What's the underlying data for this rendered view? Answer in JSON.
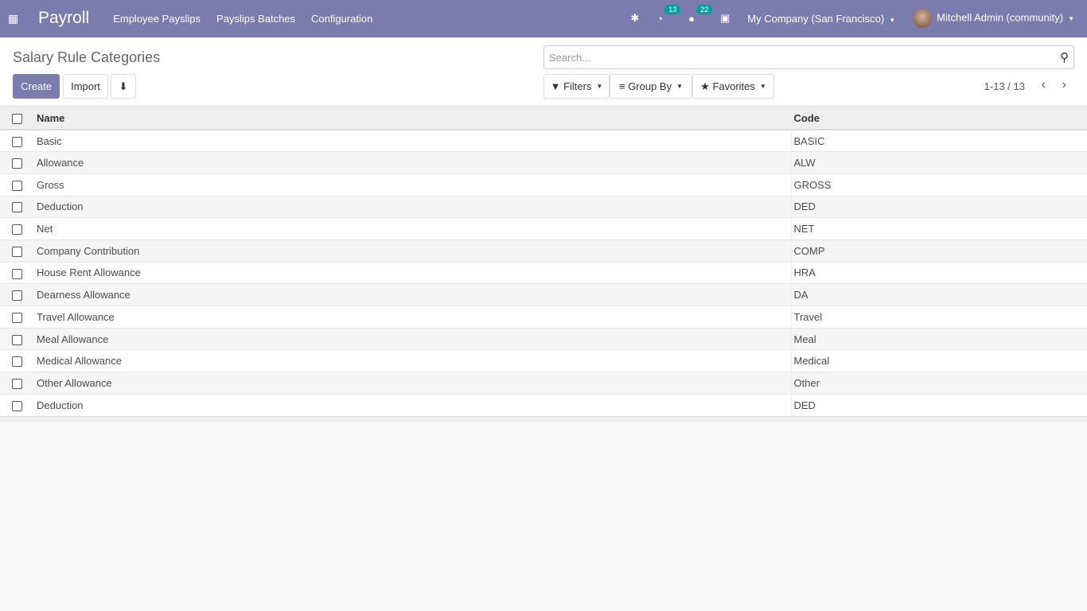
{
  "nav": {
    "brand": "Payroll",
    "menus": [
      "Employee Payslips",
      "Payslips Batches",
      "Configuration"
    ],
    "activity_count": "13",
    "message_count": "22",
    "company": "My Company (San Francisco)",
    "user": "Mitchell Admin (community)"
  },
  "control": {
    "title": "Salary Rule Categories",
    "create": "Create",
    "import": "Import",
    "search_placeholder": "Search...",
    "filters": "Filters",
    "group_by": "Group By",
    "favorites": "Favorites",
    "pager": "1-13 / 13"
  },
  "table": {
    "headers": [
      "Name",
      "Code"
    ],
    "rows": [
      [
        "Basic",
        "BASIC"
      ],
      [
        "Allowance",
        "ALW"
      ],
      [
        "Gross",
        "GROSS"
      ],
      [
        "Deduction",
        "DED"
      ],
      [
        "Net",
        "NET"
      ],
      [
        "Company Contribution",
        "COMP"
      ],
      [
        "House Rent Allowance",
        "HRA"
      ],
      [
        "Dearness Allowance",
        "DA"
      ],
      [
        "Travel Allowance",
        "Travel"
      ],
      [
        "Meal Allowance",
        "Meal"
      ],
      [
        "Medical Allowance",
        "Medical"
      ],
      [
        "Other Allowance",
        "Other"
      ],
      [
        "Deduction",
        "DED"
      ]
    ]
  }
}
